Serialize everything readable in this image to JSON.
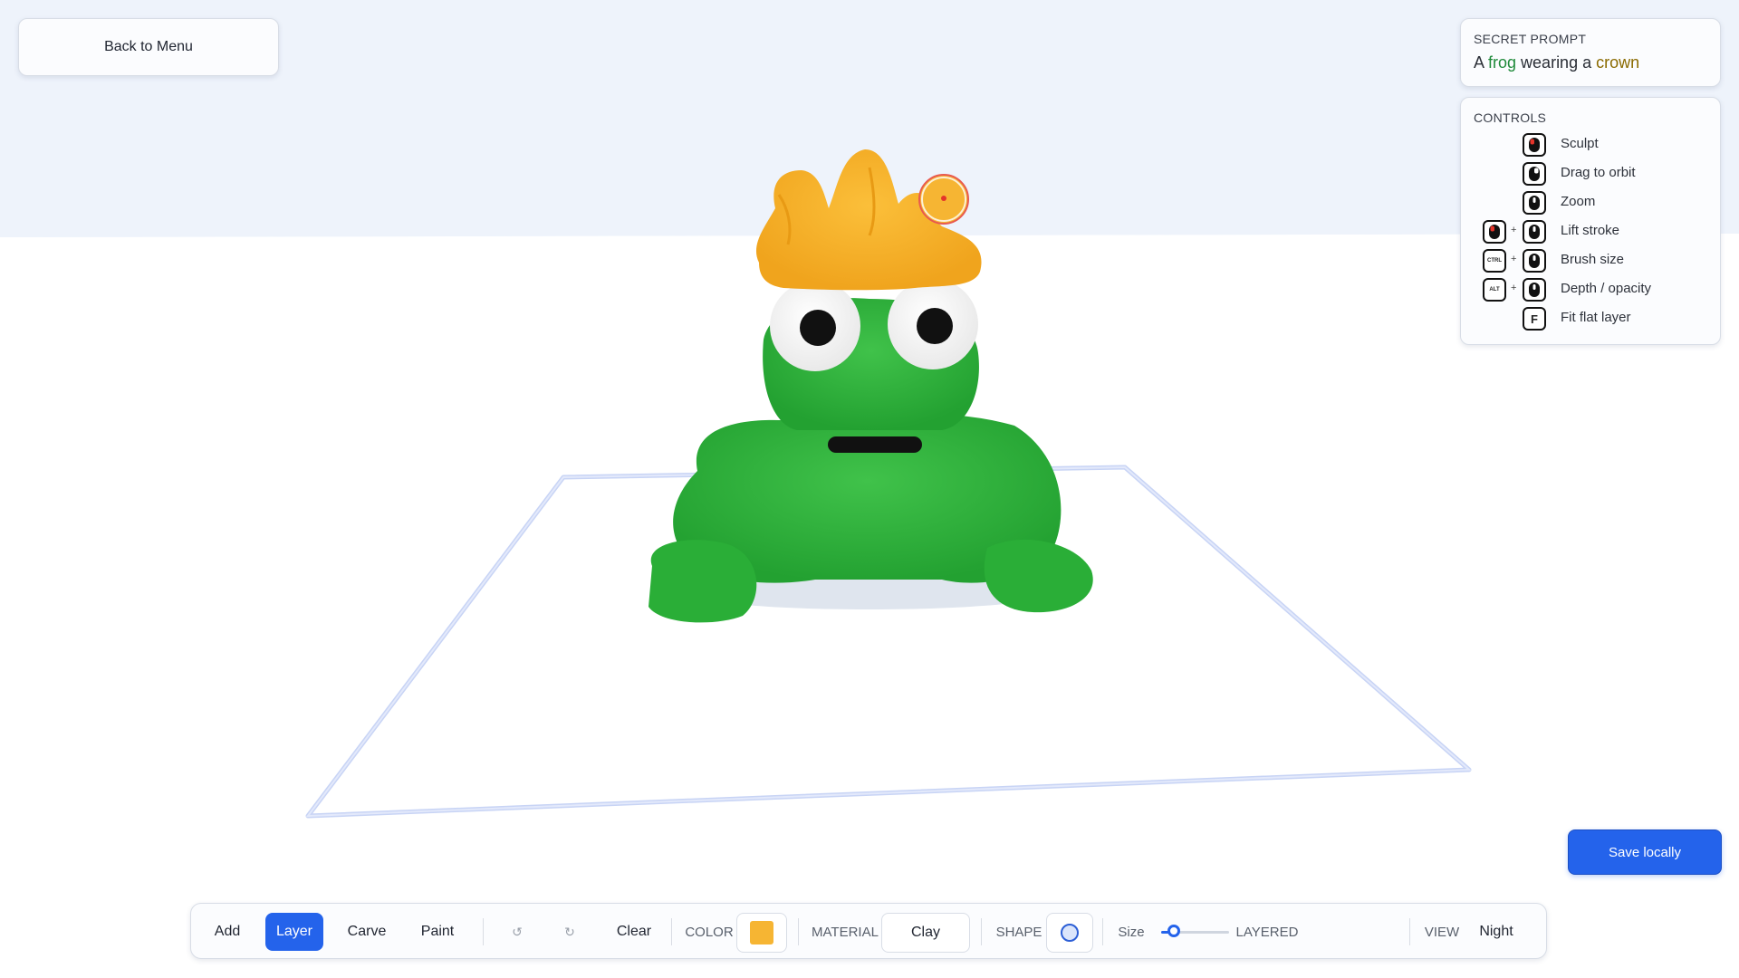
{
  "back_button": {
    "label": "Back to Menu"
  },
  "prompt": {
    "title": "SECRET PROMPT",
    "text_parts": [
      "A ",
      "frog",
      " wearing a ",
      "crown"
    ]
  },
  "controls": {
    "title": "CONTROLS",
    "items": [
      {
        "label": "Sculpt",
        "keys": [
          "mouse-left-icon"
        ]
      },
      {
        "label": "Drag to orbit",
        "keys": [
          "mouse-right-icon"
        ]
      },
      {
        "label": "Zoom",
        "keys": [
          "mouse-wheel-icon"
        ]
      },
      {
        "label": "Lift stroke",
        "keys": [
          "mouse-left-icon",
          "mouse-wheel-icon"
        ]
      },
      {
        "label": "Brush size",
        "keys": [
          "ctrl-key-icon",
          "mouse-wheel-icon"
        ],
        "modifier_text": "CTRL"
      },
      {
        "label": "Depth / opacity",
        "keys": [
          "alt-key-icon",
          "mouse-wheel-icon"
        ],
        "modifier_text": "ALT"
      },
      {
        "label": "Fit flat layer",
        "keys": [
          "f-key-icon"
        ],
        "key_text": "F"
      }
    ]
  },
  "save_button": {
    "label": "Save locally"
  },
  "toolbar": {
    "tools": [
      {
        "label": "Add",
        "active": false
      },
      {
        "label": "Layer",
        "active": true
      },
      {
        "label": "Carve",
        "active": false
      },
      {
        "label": "Paint",
        "active": false
      }
    ],
    "undo_icon": "↺",
    "redo_icon": "↻",
    "clear_label": "Clear",
    "color_label": "COLOR",
    "color_value": "#f6b533",
    "material_label": "MATERIAL",
    "material_value": "Clay",
    "shape_label": "SHAPE",
    "shape_value": "sphere",
    "size_label": "Size",
    "size_level": 0.18,
    "layered_label": "LAYERED",
    "view_label": "VIEW",
    "view_value": "Night"
  },
  "colors": {
    "accent": "#2463eb",
    "frog_green": "#2bb33a",
    "crown_yellow": "#f6b533"
  }
}
